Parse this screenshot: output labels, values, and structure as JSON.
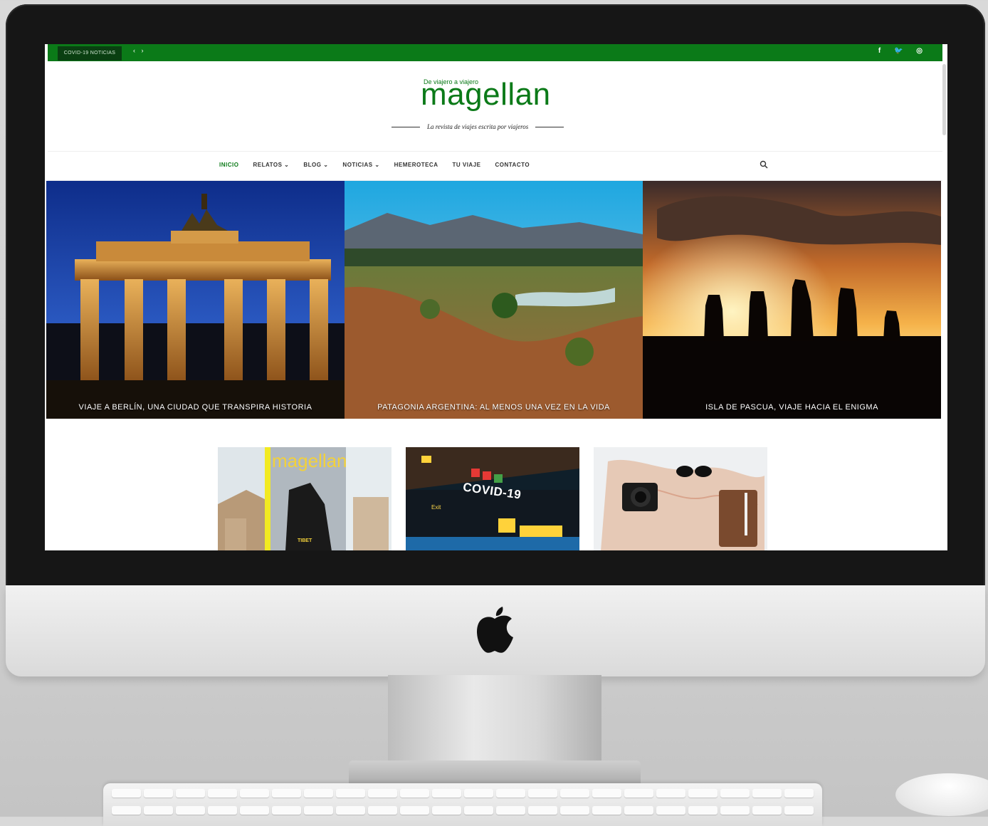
{
  "topbar": {
    "ticker_label": "COVID-19 NOTICIAS",
    "prev_arrow": "‹",
    "next_arrow": "›",
    "social": {
      "facebook": "f",
      "twitter": "🐦",
      "instagram": "◎"
    }
  },
  "header": {
    "logo_tagline_small": "De viajero a viajero",
    "logo": "magellan",
    "tagline": "La revista de viajes escrita por viajeros"
  },
  "nav": {
    "items": [
      {
        "label": "INICIO",
        "active": true
      },
      {
        "label": "RELATOS ⌄"
      },
      {
        "label": "BLOG ⌄"
      },
      {
        "label": "NOTICIAS ⌄"
      },
      {
        "label": "HEMEROTECA"
      },
      {
        "label": "TU VIAJE"
      },
      {
        "label": "CONTACTO"
      }
    ]
  },
  "slides": [
    {
      "caption": "VIAJE A BERLÍN, UNA CIUDAD QUE TRANSPIRA HISTORIA"
    },
    {
      "caption": "PATAGONIA ARGENTINA: AL MENOS UNA VEZ EN LA VIDA"
    },
    {
      "caption": "ISLA DE PASCUA, VIAJE HACIA EL ENIGMA"
    }
  ],
  "thumbs": {
    "magazine": {
      "title": "magellan",
      "subtitle": "TIBET"
    },
    "covid": {
      "board_text": "COVID-19",
      "exit_text": "Exit"
    }
  },
  "colors": {
    "brand_green": "#0b7a18",
    "dark_green": "#0a3f11"
  }
}
